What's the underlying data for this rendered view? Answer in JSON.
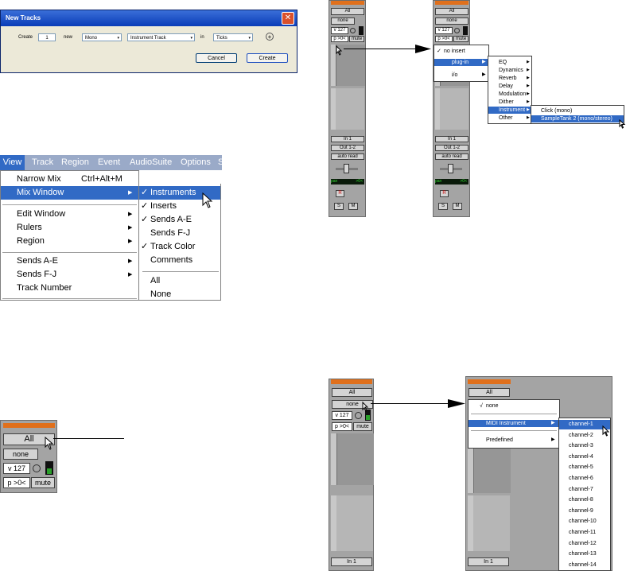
{
  "new_tracks": {
    "title": "New Tracks",
    "create_label": "Create",
    "count": "1",
    "new_label": "new",
    "format": "Mono",
    "type": "Instrument Track",
    "in_label": "in",
    "timebase": "Ticks",
    "cancel": "Cancel",
    "create_btn": "Create"
  },
  "menubar": {
    "items": [
      "View",
      "Track",
      "Region",
      "Event",
      "AudioSuite",
      "Options",
      "S"
    ]
  },
  "view_menu": {
    "items": [
      {
        "label": "Narrow Mix",
        "shortcut": "Ctrl+Alt+M"
      },
      {
        "label": "Mix Window",
        "shortcut": ""
      },
      {
        "label": "Edit Window",
        "shortcut": ""
      },
      {
        "label": "Rulers",
        "shortcut": ""
      },
      {
        "label": "Region",
        "shortcut": ""
      },
      {
        "label": "Sends A-E",
        "shortcut": ""
      },
      {
        "label": "Sends F-J",
        "shortcut": ""
      },
      {
        "label": "Track Number",
        "shortcut": ""
      }
    ]
  },
  "mix_submenu": {
    "items": [
      "Instruments",
      "Inserts",
      "Sends A-E",
      "Sends F-J",
      "Track Color",
      "Comments",
      "All",
      "None"
    ],
    "check": "✓"
  },
  "strip_small": {
    "all": "All",
    "none": "none",
    "vel": "v 127",
    "p": "p >0<",
    "mute": "mute"
  },
  "mixer": {
    "all": "All",
    "none": "none",
    "vel": "v 127",
    "p": "p >0<",
    "mute": "mute",
    "in": "In 1",
    "out": "Out 1-2",
    "auto": "auto read",
    "pan": "pan",
    "pan_val": ">0<",
    "r": "R",
    "s": "S",
    "m": "M"
  },
  "insert_menu": {
    "no_insert": "no insert",
    "plugin": "plug-in",
    "io": "i/o",
    "check": "✓"
  },
  "plugin_menu": {
    "items": [
      "EQ",
      "Dynamics",
      "Reverb",
      "Delay",
      "Modulation",
      "Dither",
      "Instrument",
      "Other"
    ]
  },
  "instrument_menu": {
    "items": [
      "Click (mono)",
      "SampleTank 2 (mono/stereo)"
    ]
  },
  "midi_menu": {
    "none": "none",
    "midi_instrument": "MIDI Instrument",
    "predefined": "Predefined",
    "check": "√"
  },
  "channels": [
    "channel-1",
    "channel-2",
    "channel-3",
    "channel-4",
    "channel-5",
    "channel-6",
    "channel-7",
    "channel-8",
    "channel-9",
    "channel-10",
    "channel-11",
    "channel-12",
    "channel-13",
    "channel-14"
  ]
}
